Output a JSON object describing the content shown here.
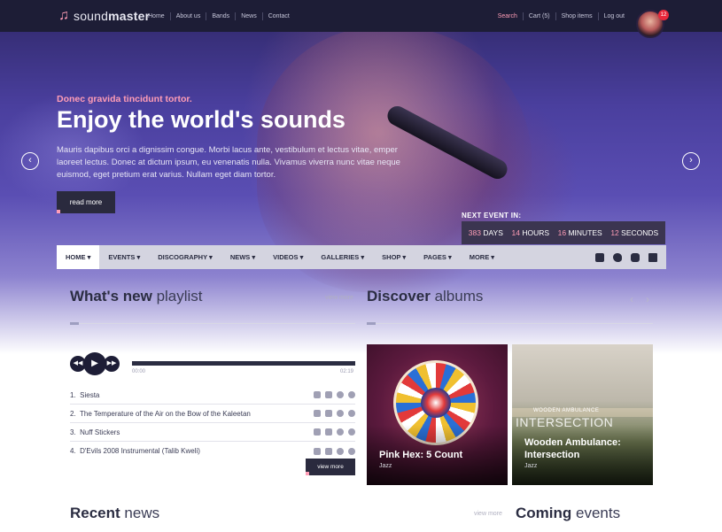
{
  "topbar": {
    "logo": {
      "light": "sound",
      "bold": "master"
    },
    "nav": [
      "Home",
      "About us",
      "Bands",
      "News",
      "Contact"
    ],
    "links": [
      "Search",
      "Cart (5)",
      "Shop items",
      "Log out"
    ],
    "notification_count": "12"
  },
  "hero": {
    "kicker": "Donec gravida tincidunt tortor.",
    "title": "Enjoy the world's sounds",
    "body": "Mauris dapibus orci a dignissim congue. Morbi lacus ante, vestibulum et lectus vitae, emper laoreet lectus. Donec at dictum ipsum, eu venenatis nulla. Vivamus viverra nunc vitae neque euismod, eget pretium erat varius. Nullam eget diam tortor.",
    "button": "read more",
    "prev_arrow": "‹",
    "next_arrow": "›"
  },
  "countdown": {
    "label": "NEXT EVENT IN:",
    "days_value": "383",
    "days_unit": "DAYS",
    "hours_value": "14",
    "hours_unit": "HOURS",
    "minutes_value": "16",
    "minutes_unit": "MINUTES",
    "seconds_value": "12",
    "seconds_unit": "SECONDS"
  },
  "mainnav": {
    "items": [
      "HOME",
      "EVENTS",
      "DISCOGRAPHY",
      "NEWS",
      "VIDEOS",
      "GALLERIES",
      "SHOP",
      "PAGES",
      "MORE"
    ],
    "caret": "▾",
    "social_icons": [
      "facebook-icon",
      "twitter-icon",
      "youtube-icon",
      "linkedin-icon"
    ]
  },
  "whats_new": {
    "title_bold": "What's new",
    "title_light": "playlist",
    "view_more": "view more",
    "player": {
      "prev": "◀◀",
      "play": "▶",
      "next": "▶▶",
      "time_start": "00:00",
      "time_end": "02:19"
    },
    "tracks": [
      {
        "num": "1.",
        "title": "Siesta"
      },
      {
        "num": "2.",
        "title": "The Temperature of the Air on the Bow of the Kaleetan"
      },
      {
        "num": "3.",
        "title": "Nuff Stickers"
      },
      {
        "num": "4.",
        "title": "D'Evils 2008 Instrumental (Talib Kweli)"
      }
    ],
    "button": "view more"
  },
  "discover": {
    "title_bold": "Discover",
    "title_light": "albums",
    "prev": "‹",
    "next": "›",
    "albums": [
      {
        "title": "Pink Hex: 5 Count",
        "genre": "Jazz"
      },
      {
        "title": "Wooden Ambulance: Intersection",
        "genre": "Jazz",
        "cover_small": "WOODEN AMBULANCE",
        "cover_big": "INTERSECTION"
      }
    ]
  },
  "recent_news": {
    "title_bold": "Recent",
    "title_light": "news",
    "view_more": "view more"
  },
  "coming_events": {
    "title_bold": "Coming",
    "title_light": "events"
  }
}
